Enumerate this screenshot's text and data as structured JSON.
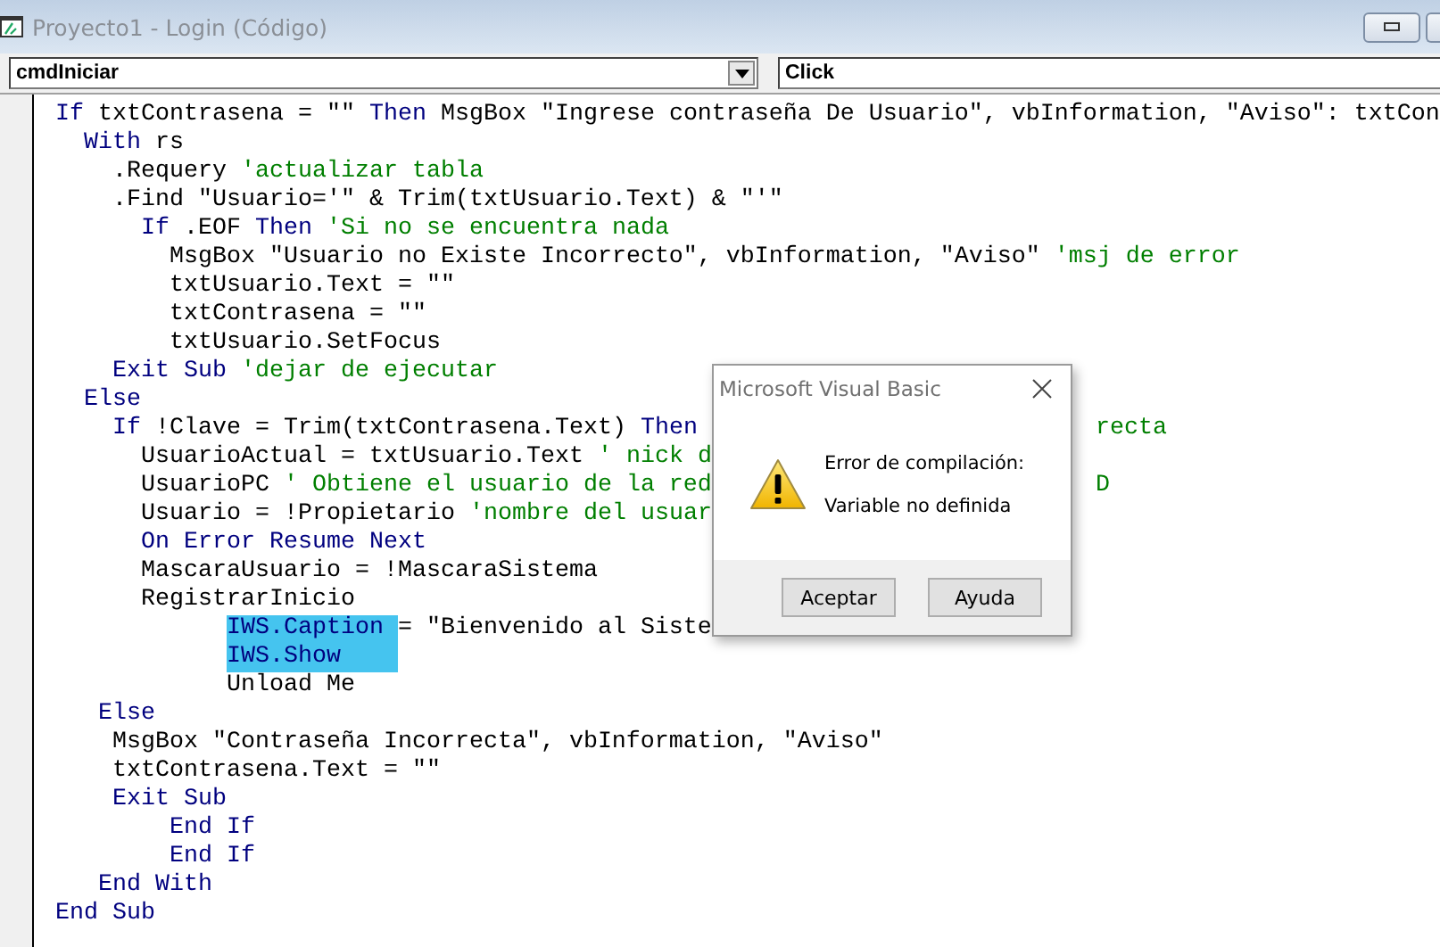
{
  "window": {
    "title": "Proyecto1 - Login (Código)"
  },
  "object_combo": {
    "value": "cmdIniciar"
  },
  "procedure_combo": {
    "value": "Click"
  },
  "code_lines": [
    {
      "segments": [
        {
          "kind": "kw",
          "text": "If"
        },
        {
          "kind": "txt",
          "text": " txtContrasena = \"\" "
        },
        {
          "kind": "kw",
          "text": "Then"
        },
        {
          "kind": "txt",
          "text": " MsgBox \"Ingrese contraseña De Usuario\", vbInformation, \"Aviso\": txtCon"
        }
      ]
    },
    {
      "segments": [
        {
          "kind": "kw",
          "text": "  With"
        },
        {
          "kind": "txt",
          "text": " rs"
        }
      ]
    },
    {
      "segments": [
        {
          "kind": "txt",
          "text": "    .Requery "
        },
        {
          "kind": "cm",
          "text": "'actualizar tabla"
        }
      ]
    },
    {
      "segments": [
        {
          "kind": "txt",
          "text": "    .Find \"Usuario='\" & Trim(txtUsuario.Text) & \"'\""
        }
      ]
    },
    {
      "segments": [
        {
          "kind": "kw",
          "text": "      If"
        },
        {
          "kind": "txt",
          "text": " .EOF "
        },
        {
          "kind": "kw",
          "text": "Then"
        },
        {
          "kind": "cm",
          "text": " 'Si no se encuentra nada"
        }
      ]
    },
    {
      "segments": [
        {
          "kind": "txt",
          "text": "        MsgBox \"Usuario no Existe Incorrecto\", vbInformation, \"Aviso\" "
        },
        {
          "kind": "cm",
          "text": "'msj de error"
        }
      ]
    },
    {
      "segments": [
        {
          "kind": "txt",
          "text": "        txtUsuario.Text = \"\""
        }
      ]
    },
    {
      "segments": [
        {
          "kind": "txt",
          "text": "        txtContrasena = \"\""
        }
      ]
    },
    {
      "segments": [
        {
          "kind": "txt",
          "text": "        txtUsuario.SetFocus"
        }
      ]
    },
    {
      "segments": [
        {
          "kind": "kw",
          "text": "    Exit Sub"
        },
        {
          "kind": "cm",
          "text": " 'dejar de ejecutar"
        }
      ]
    },
    {
      "segments": [
        {
          "kind": "kw",
          "text": "  Else"
        }
      ]
    },
    {
      "segments": [
        {
          "kind": "kw",
          "text": "    If"
        },
        {
          "kind": "txt",
          "text": " !Clave = Trim(txtContrasena.Text) "
        },
        {
          "kind": "kw",
          "text": "Then"
        }
      ],
      "after_dialog": [
        {
          "kind": "cm",
          "text": "recta"
        }
      ]
    },
    {
      "segments": [
        {
          "kind": "txt",
          "text": "      UsuarioActual = txtUsuario.Text "
        },
        {
          "kind": "cm",
          "text": "' nick d"
        }
      ]
    },
    {
      "segments": [
        {
          "kind": "txt",
          "text": "      UsuarioPC "
        },
        {
          "kind": "cm",
          "text": "' Obtiene el usuario de la red"
        }
      ],
      "after_dialog": [
        {
          "kind": "cm",
          "text": "D"
        }
      ]
    },
    {
      "segments": [
        {
          "kind": "txt",
          "text": "      Usuario = !Propietario "
        },
        {
          "kind": "cm",
          "text": "'nombre del usuar"
        }
      ]
    },
    {
      "segments": [
        {
          "kind": "kw",
          "text": "      On Error Resume Next"
        }
      ]
    },
    {
      "segments": [
        {
          "kind": "txt",
          "text": "      MascaraUsuario = !MascaraSistema"
        }
      ]
    },
    {
      "segments": [
        {
          "kind": "txt",
          "text": "      RegistrarInicio"
        }
      ]
    },
    {
      "segments": [
        {
          "kind": "sel",
          "text": "            IWS.Caption "
        },
        {
          "kind": "txt",
          "text": "= \"Bienvenido al Siste"
        }
      ]
    },
    {
      "segments": [
        {
          "kind": "sel",
          "text": "            IWS.Show"
        }
      ]
    },
    {
      "segments": [
        {
          "kind": "txt",
          "text": "            Unload Me"
        }
      ]
    },
    {
      "segments": [
        {
          "kind": "kw",
          "text": "   Else"
        }
      ]
    },
    {
      "segments": [
        {
          "kind": "txt",
          "text": "    MsgBox \"Contraseña Incorrecta\", vbInformation, \"Aviso\""
        }
      ]
    },
    {
      "segments": [
        {
          "kind": "txt",
          "text": "    txtContrasena.Text = \"\""
        }
      ]
    },
    {
      "segments": [
        {
          "kind": "kw",
          "text": "    Exit Sub"
        }
      ]
    },
    {
      "segments": [
        {
          "kind": "kw",
          "text": "        End If"
        }
      ]
    },
    {
      "segments": [
        {
          "kind": "kw",
          "text": "        End If"
        }
      ]
    },
    {
      "segments": [
        {
          "kind": "kw",
          "text": "   End With"
        }
      ]
    },
    {
      "segments": [
        {
          "kind": "kw",
          "text": "End Sub"
        }
      ]
    }
  ],
  "dialog": {
    "title": "Microsoft Visual Basic",
    "heading": "Error de compilación:",
    "message": "Variable no definida",
    "buttons": [
      {
        "label": "Aceptar"
      },
      {
        "label": "Ayuda"
      }
    ]
  }
}
